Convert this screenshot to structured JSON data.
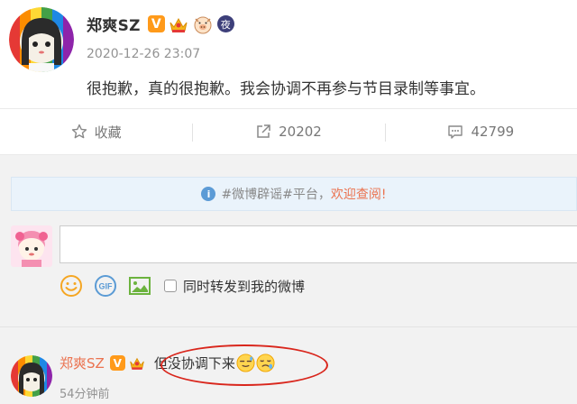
{
  "post": {
    "author_name": "郑爽SZ",
    "badges": [
      "verified-v-badge",
      "crown-badge",
      "pig-badge",
      "night-badge"
    ],
    "badge_v_text": "V",
    "badge_ye_text": "夜",
    "timestamp": "2020-12-26 23:07",
    "content": "很抱歉，真的很抱歉。我会协调不再参与节目录制等事宜。"
  },
  "actions": {
    "favorite_label": "收藏",
    "repost_count": "20202",
    "comment_count": "42799"
  },
  "comments": {
    "notice_prefix": "#微博辟谣#平台，",
    "notice_link": "欢迎查阅!",
    "input_placeholder": "",
    "sync_label": "同时转发到我的微博",
    "tool_icons": [
      "emoji-icon",
      "gif-icon",
      "image-icon"
    ],
    "reply": {
      "author_name": "郑爽SZ",
      "badge_v_text": "V",
      "text": "但没协调下来",
      "emojis": [
        "sweat-smile-emoji",
        "sad-sweat-emoji"
      ],
      "time": "54分钟前"
    }
  },
  "colors": {
    "accent_orange": "#eb7350",
    "highlight_red": "#d9261c",
    "notice_bg": "#eaf3fb",
    "info_blue": "#5c9bd6"
  }
}
